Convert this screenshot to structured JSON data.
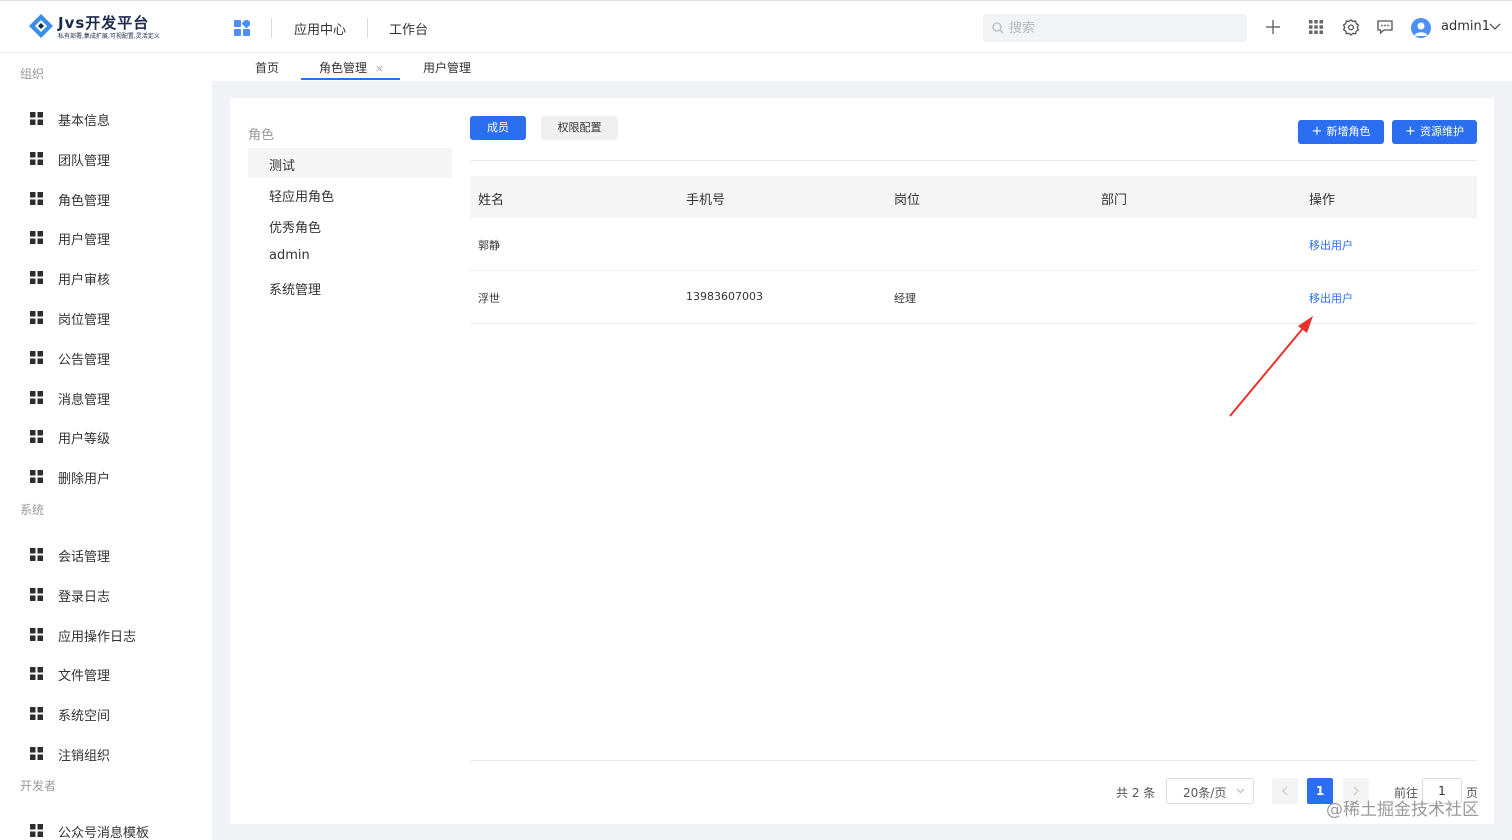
{
  "header": {
    "logo_title": "Jvs开发平台",
    "logo_subtitle": "私有部署,集成扩展,可视配置,灵活定义",
    "nav": [
      "应用中心",
      "工作台"
    ],
    "search_placeholder": "搜索",
    "username": "admin1",
    "icons": [
      "grid-app-icon",
      "plus-icon",
      "apps-grid-icon",
      "settings-icon",
      "message-icon",
      "avatar-icon",
      "chevron-down-icon"
    ]
  },
  "tabs": [
    {
      "label": "首页"
    },
    {
      "label": "角色管理",
      "close": "×",
      "active": true
    },
    {
      "label": "用户管理"
    }
  ],
  "sidebar": {
    "groups": [
      {
        "title": "组织",
        "items": [
          "基本信息",
          "团队管理",
          "角色管理",
          "用户管理",
          "用户审核",
          "岗位管理",
          "公告管理",
          "消息管理",
          "用户等级",
          "删除用户"
        ]
      },
      {
        "title": "系统",
        "items": [
          "会话管理",
          "登录日志",
          "应用操作日志",
          "文件管理",
          "系统空间",
          "注销组织"
        ]
      },
      {
        "title": "开发者",
        "items": [
          "公众号消息模板"
        ]
      }
    ]
  },
  "roles": {
    "title": "角色",
    "items": [
      "测试",
      "轻应用角色",
      "优秀角色",
      "admin",
      "系统管理"
    ],
    "selected_index": 0
  },
  "toolbar": {
    "members_tab": "成员",
    "permissions_tab": "权限配置",
    "add_role": "新增角色",
    "resource_maintain": "资源维护"
  },
  "table": {
    "columns": [
      "姓名",
      "手机号",
      "岗位",
      "部门",
      "操作"
    ],
    "rows": [
      {
        "name": "郭静",
        "phone": "",
        "position": "",
        "dept": "",
        "action": "移出用户"
      },
      {
        "name": "浮世",
        "phone": "13983607003",
        "position": "经理",
        "dept": "",
        "action": "移出用户"
      }
    ]
  },
  "pagination": {
    "total": "共 2 条",
    "page_size": "20条/页",
    "current_page": "1",
    "goto_label": "前往",
    "goto_value": "1",
    "page_suffix": "页"
  },
  "watermark": "@稀土掘金技术社区",
  "colors": {
    "accent": "#2b6ff0",
    "annotation_arrow": "#e8322b"
  }
}
